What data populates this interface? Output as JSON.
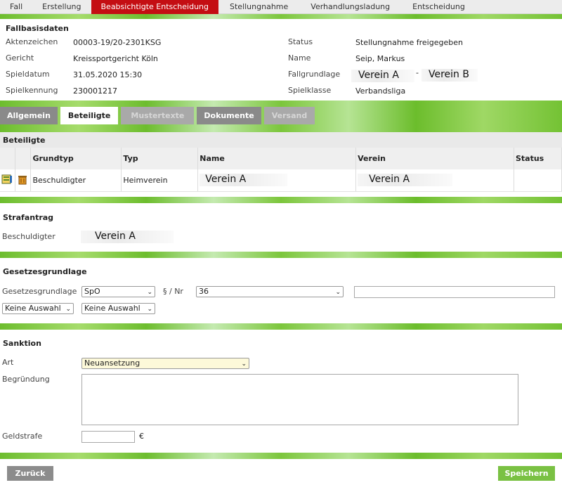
{
  "top_tabs": [
    "Fall",
    "Erstellung",
    "Beabsichtigte Entscheidung",
    "Stellungnahme",
    "Verhandlungsladung",
    "Entscheidung"
  ],
  "fallbasisdaten": {
    "title": "Fallbasisdaten",
    "aktenzeichen_label": "Aktenzeichen",
    "aktenzeichen": "00003-19/20-2301KSG",
    "gericht_label": "Gericht",
    "gericht": "Kreissportgericht Köln",
    "spieldatum_label": "Spieldatum",
    "spieldatum": "31.05.2020 15:30",
    "spielkennung_label": "Spielkennung",
    "spielkennung": "230001217",
    "status_label": "Status",
    "status": "Stellungnahme freigegeben",
    "name_label": "Name",
    "name": "Seip, Markus",
    "fallgrundlage_label": "Fallgrundlage",
    "fallgrundlage_a": "Verein A",
    "fallgrundlage_sep": "-",
    "fallgrundlage_b": "Verein B",
    "spielklasse_label": "Spielklasse",
    "spielklasse": "Verbandsliga"
  },
  "sub_tabs": [
    "Allgemein",
    "Beteiligte",
    "Mustertexte",
    "Dokumente",
    "Versand"
  ],
  "beteiligte": {
    "title": "Beteiligte",
    "columns": [
      "Grundtyp",
      "Typ",
      "Name",
      "Verein",
      "Status"
    ],
    "rows": [
      {
        "grundtyp": "Beschuldigter",
        "typ": "Heimverein",
        "name": "Verein A",
        "verein": "Verein A",
        "status": ""
      }
    ],
    "icon_edit": "edit-icon",
    "icon_delete": "trash-icon"
  },
  "strafantrag": {
    "title": "Strafantrag",
    "beschuldigter_label": "Beschuldigter",
    "beschuldigter": "Verein A"
  },
  "gesetzesgrundlage": {
    "title": "Gesetzesgrundlage",
    "label": "Gesetzesgrundlage",
    "select1": "SpO",
    "paragraph_label": "§ / Nr",
    "select2": "36",
    "text_value": "",
    "select3": "Keine Auswahl",
    "select4": "Keine Auswahl"
  },
  "sanktion": {
    "title": "Sanktion",
    "art_label": "Art",
    "art": "Neuansetzung",
    "begruendung_label": "Begründung",
    "begruendung": "",
    "geldstrafe_label": "Geldstrafe",
    "geldstrafe": "",
    "currency": "€"
  },
  "buttons": {
    "back": "Zurück",
    "save": "Speichern"
  },
  "colors": {
    "active_tab": "#c40e13",
    "save_button": "#7ac143",
    "back_button": "#8c8c8c",
    "band_green": "#74c234"
  }
}
